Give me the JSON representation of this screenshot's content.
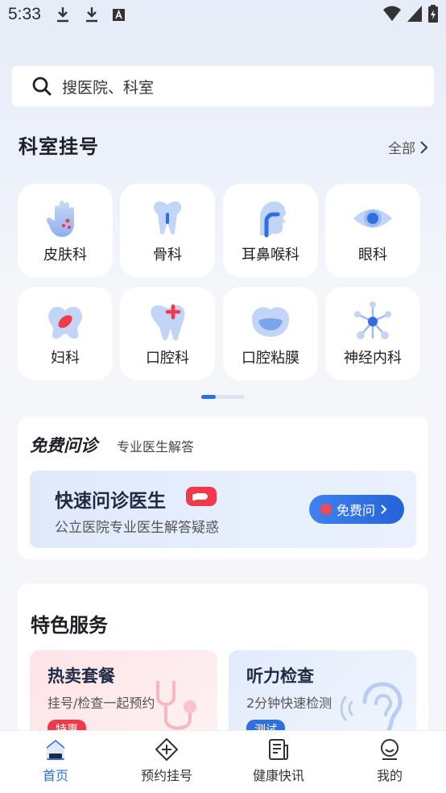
{
  "status_bar": {
    "time": "5:33"
  },
  "search": {
    "placeholder": "搜医院、科室"
  },
  "departments": {
    "title": "科室挂号",
    "all_label": "全部",
    "items": [
      {
        "label": "皮肤科",
        "icon": "skin-hand-icon"
      },
      {
        "label": "骨科",
        "icon": "bone-icon"
      },
      {
        "label": "耳鼻喉科",
        "icon": "ent-head-icon"
      },
      {
        "label": "眼科",
        "icon": "eye-icon"
      },
      {
        "label": "妇科",
        "icon": "gynecology-icon"
      },
      {
        "label": "口腔科",
        "icon": "tooth-plus-icon"
      },
      {
        "label": "口腔粘膜",
        "icon": "mouth-icon"
      },
      {
        "label": "神经内科",
        "icon": "neuron-icon"
      }
    ],
    "page_index": 1,
    "page_count": 3
  },
  "free_consult": {
    "title": "免费问诊",
    "subtitle": "专业医生解答",
    "banner_title": "快速问诊医生",
    "banner_subtitle": "公立医院专业医生解答疑惑",
    "button_label": "免费问"
  },
  "services": {
    "title": "特色服务",
    "items": [
      {
        "name": "热卖套餐",
        "desc": "挂号/检查一起预约",
        "tag": "特惠"
      },
      {
        "name": "听力检查",
        "desc": "2分钟快速检测",
        "tag": "测试"
      }
    ]
  },
  "bottom_nav": {
    "items": [
      {
        "label": "首页",
        "active": true
      },
      {
        "label": "预约挂号",
        "active": false
      },
      {
        "label": "健康快讯",
        "active": false
      },
      {
        "label": "我的",
        "active": false
      }
    ]
  },
  "colors": {
    "accent": "#2f6fe0",
    "red": "#f0394a"
  }
}
